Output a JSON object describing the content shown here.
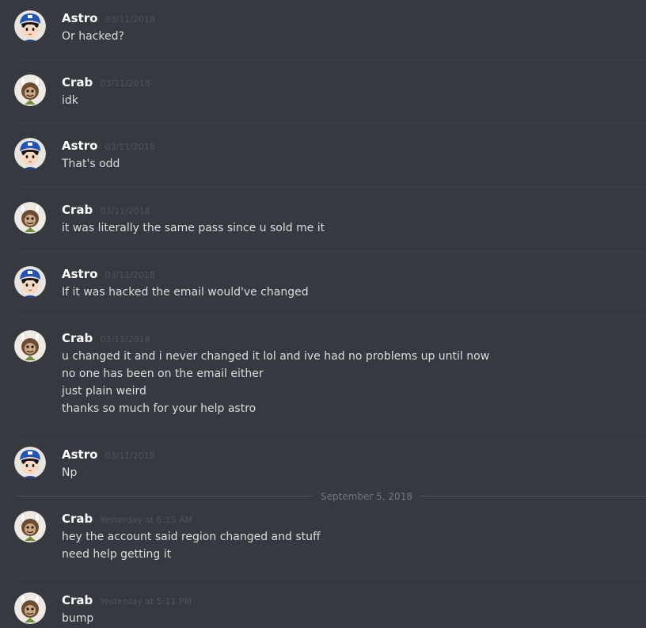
{
  "messages": [
    {
      "user": "Astro",
      "avatar": "astro",
      "time": "03/11/2018",
      "lines": [
        "Or hacked?"
      ]
    },
    {
      "user": "Crab",
      "avatar": "crab",
      "time": "03/11/2018",
      "lines": [
        "idk"
      ]
    },
    {
      "user": "Astro",
      "avatar": "astro",
      "time": "03/11/2018",
      "lines": [
        "That's odd"
      ]
    },
    {
      "user": "Crab",
      "avatar": "crab",
      "time": "03/11/2018",
      "lines": [
        "it was literally the same pass since u sold me it"
      ]
    },
    {
      "user": "Astro",
      "avatar": "astro",
      "time": "03/11/2018",
      "lines": [
        "If it was hacked the email would've changed"
      ]
    },
    {
      "user": "Crab",
      "avatar": "crab",
      "time": "03/11/2018",
      "lines": [
        "u changed it and i never changed it lol and ive had no problems up until now",
        "no one has been on the email either",
        "just plain weird",
        "thanks so much for your help astro"
      ]
    },
    {
      "user": "Astro",
      "avatar": "astro",
      "time": "03/11/2018",
      "lines": [
        "Np"
      ]
    },
    {
      "user": "Crab",
      "avatar": "crab",
      "time": "Yesterday at 6:15 AM",
      "lines": [
        "hey the account said region changed and stuff",
        "need help getting it"
      ]
    },
    {
      "user": "Crab",
      "avatar": "crab",
      "time": "Yesterday at 5:11 PM",
      "lines": [
        "bump"
      ]
    }
  ],
  "date_divider": "September 5, 2018",
  "colors": {
    "background": "#36393f",
    "username": "#ffffff",
    "timestamp": "#4f545c",
    "text": "#dcddde",
    "divider": "#3f4248"
  },
  "icons": {
    "astro": "astro-avatar-icon",
    "crab": "crab-avatar-icon"
  }
}
